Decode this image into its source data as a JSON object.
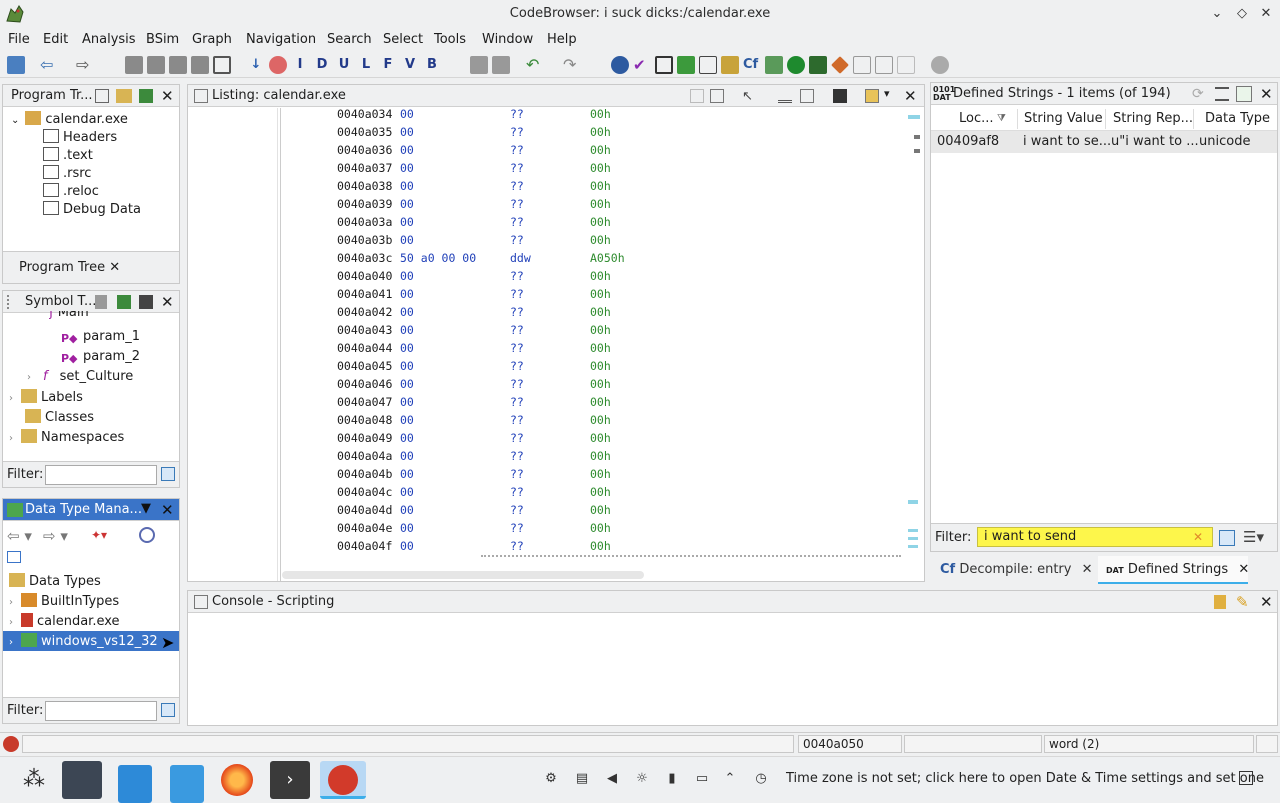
{
  "window": {
    "title": "CodeBrowser: i suck dicks:/calendar.exe"
  },
  "menu": [
    "File",
    "Edit",
    "Analysis",
    "BSim",
    "Graph",
    "Navigation",
    "Search",
    "Select",
    "Tools",
    "Window",
    "Help"
  ],
  "program_tree": {
    "title": "Program Tr...",
    "root": "calendar.exe",
    "items": [
      "Headers",
      ".text",
      ".rsrc",
      ".reloc",
      "Debug Data"
    ],
    "tab": "Program Tree"
  },
  "symbol_tree": {
    "title": "Symbol T...",
    "cut_item": "Main",
    "items": [
      {
        "label": "param_1"
      },
      {
        "label": "param_2"
      },
      {
        "label": "set_Culture"
      },
      {
        "label": "Labels"
      },
      {
        "label": "Classes"
      },
      {
        "label": "Namespaces"
      }
    ],
    "filter_label": "Filter:"
  },
  "data_type_manager": {
    "title": "Data Type Mana...",
    "root": "Data Types",
    "items": [
      "BuiltInTypes",
      "calendar.exe",
      "windows_vs12_32"
    ],
    "filter_label": "Filter:"
  },
  "listing": {
    "title": "Listing:  calendar.exe",
    "rows": [
      {
        "addr": "0040a034",
        "bytes": "00",
        "mnem": "??",
        "oper": "00h"
      },
      {
        "addr": "0040a035",
        "bytes": "00",
        "mnem": "??",
        "oper": "00h"
      },
      {
        "addr": "0040a036",
        "bytes": "00",
        "mnem": "??",
        "oper": "00h"
      },
      {
        "addr": "0040a037",
        "bytes": "00",
        "mnem": "??",
        "oper": "00h"
      },
      {
        "addr": "0040a038",
        "bytes": "00",
        "mnem": "??",
        "oper": "00h"
      },
      {
        "addr": "0040a039",
        "bytes": "00",
        "mnem": "??",
        "oper": "00h"
      },
      {
        "addr": "0040a03a",
        "bytes": "00",
        "mnem": "??",
        "oper": "00h"
      },
      {
        "addr": "0040a03b",
        "bytes": "00",
        "mnem": "??",
        "oper": "00h"
      },
      {
        "addr": "0040a03c",
        "bytes": "50 a0 00 00",
        "mnem": "ddw",
        "oper": "A050h"
      },
      {
        "addr": "0040a040",
        "bytes": "00",
        "mnem": "??",
        "oper": "00h"
      },
      {
        "addr": "0040a041",
        "bytes": "00",
        "mnem": "??",
        "oper": "00h"
      },
      {
        "addr": "0040a042",
        "bytes": "00",
        "mnem": "??",
        "oper": "00h"
      },
      {
        "addr": "0040a043",
        "bytes": "00",
        "mnem": "??",
        "oper": "00h"
      },
      {
        "addr": "0040a044",
        "bytes": "00",
        "mnem": "??",
        "oper": "00h"
      },
      {
        "addr": "0040a045",
        "bytes": "00",
        "mnem": "??",
        "oper": "00h"
      },
      {
        "addr": "0040a046",
        "bytes": "00",
        "mnem": "??",
        "oper": "00h"
      },
      {
        "addr": "0040a047",
        "bytes": "00",
        "mnem": "??",
        "oper": "00h"
      },
      {
        "addr": "0040a048",
        "bytes": "00",
        "mnem": "??",
        "oper": "00h"
      },
      {
        "addr": "0040a049",
        "bytes": "00",
        "mnem": "??",
        "oper": "00h"
      },
      {
        "addr": "0040a04a",
        "bytes": "00",
        "mnem": "??",
        "oper": "00h"
      },
      {
        "addr": "0040a04b",
        "bytes": "00",
        "mnem": "??",
        "oper": "00h"
      },
      {
        "addr": "0040a04c",
        "bytes": "00",
        "mnem": "??",
        "oper": "00h"
      },
      {
        "addr": "0040a04d",
        "bytes": "00",
        "mnem": "??",
        "oper": "00h"
      },
      {
        "addr": "0040a04e",
        "bytes": "00",
        "mnem": "??",
        "oper": "00h"
      },
      {
        "addr": "0040a04f",
        "bytes": "00",
        "mnem": "??",
        "oper": "00h"
      }
    ]
  },
  "defined_strings": {
    "title": "Defined Strings - 1 items (of 194)",
    "columns": [
      "Loc...",
      "String Value",
      "String Rep...",
      "Data Type"
    ],
    "rows": [
      {
        "loc": "00409af8",
        "value": "i want to se...",
        "rep": "u\"i want to ...",
        "type": "unicode"
      }
    ],
    "filter_label": "Filter:",
    "filter_value": "i want to send"
  },
  "right_tabs": [
    "Decompile: entry",
    "Defined Strings"
  ],
  "console": {
    "title": "Console - Scripting"
  },
  "status": {
    "address": "0040a050",
    "type": "word  (2)"
  },
  "tray": {
    "timezone_msg": "Time zone is not set; click here to open Date & Time settings and set one"
  },
  "colors": {
    "selection": "#3a74c8",
    "filter_highlight": "#fdf64b",
    "accent": "#3daee9"
  }
}
